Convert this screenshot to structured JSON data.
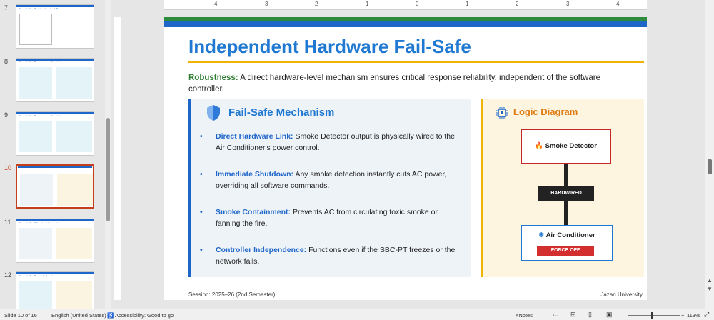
{
  "thumbnails": [
    {
      "num": "7",
      "title": "Branch 1 – Control Logic & Programming"
    },
    {
      "num": "8",
      "title": "Branch 1 – Emergency Simulations"
    },
    {
      "num": "9",
      "title": "Branch 1 – Emergency Simulations"
    },
    {
      "num": "10",
      "title": "Independent Hardware Fail-Safe"
    },
    {
      "num": "11",
      "title": "Branch 2 – Climate & Security"
    },
    {
      "num": "12",
      "title": "Branch 3 – Flood & Smoke"
    }
  ],
  "ruler_marks": [
    "4",
    "3",
    "2",
    "1",
    "0",
    "1",
    "2",
    "3",
    "4"
  ],
  "slide": {
    "title": "Independent Hardware Fail-Safe",
    "robustness_label": "Robustness:",
    "robustness_text": "A direct hardware-level mechanism ensures critical response reliability, independent of the software controller.",
    "mechanism_heading": "Fail-Safe Mechanism",
    "bullets": [
      {
        "key": "Direct Hardware Link:",
        "text": "Smoke Detector output is physically wired to the Air Conditioner's power control."
      },
      {
        "key": "Immediate Shutdown:",
        "text": "Any smoke detection instantly cuts AC power, overriding all software commands."
      },
      {
        "key": "Smoke Containment:",
        "text": "Prevents AC from circulating toxic smoke or fanning the fire."
      },
      {
        "key": "Controller Independence:",
        "text": "Functions even if the SBC-PT freezes or the network fails."
      }
    ],
    "logic_heading": "Logic Diagram",
    "smoke_detector": "Smoke Detector",
    "hardwired": "HARDWIRED",
    "air_conditioner": "Air Conditioner",
    "force_off": "FORCE OFF",
    "footer_left": "Session: 2025–26 (2nd Semester)",
    "footer_right": "Jazan University"
  },
  "status": {
    "slide_count": "Slide 10 of 16",
    "language": "English (United States)",
    "accessibility": "Accessibility: Good to go",
    "notes": "Notes",
    "zoom_minus": "–",
    "zoom_plus": "+",
    "zoom": "113%"
  },
  "colors": {
    "accent_blue": "#1f66c9",
    "accent_gold": "#f0b400",
    "accent_green": "#2e8b3c",
    "active_red": "#c43e1c"
  }
}
